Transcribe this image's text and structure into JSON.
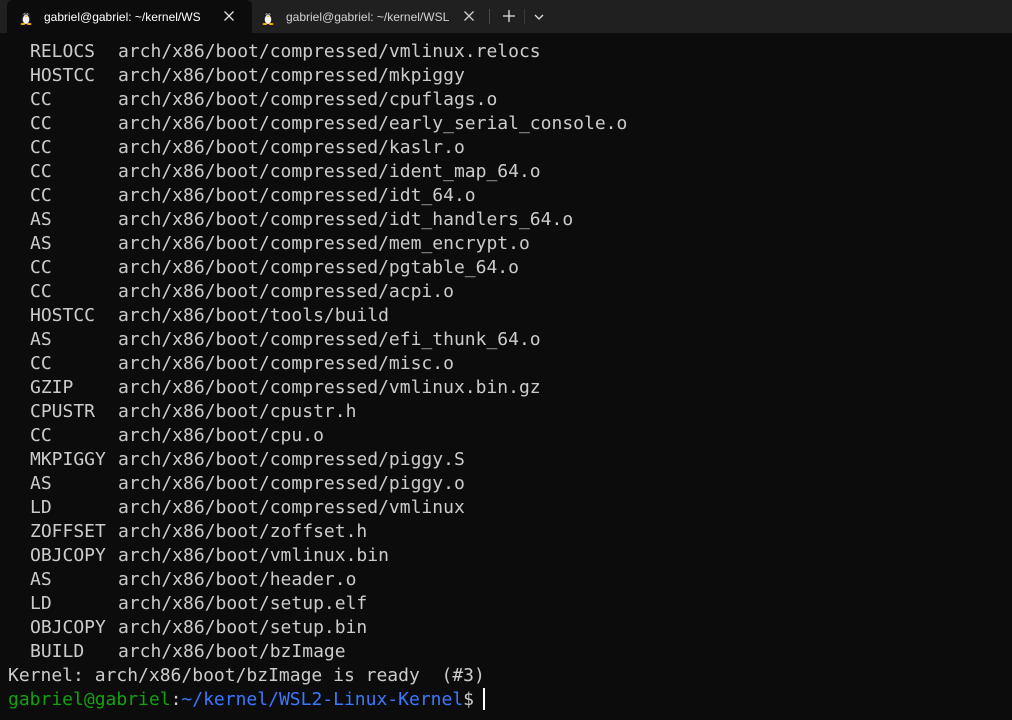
{
  "tabs": [
    {
      "title": "gabriel@gabriel: ~/kernel/WS",
      "active": true,
      "icon": "tux-icon"
    },
    {
      "title": "gabriel@gabriel: ~/kernel/WSL",
      "active": false,
      "icon": "tux-icon"
    }
  ],
  "tabbar": {
    "new_tab_icon": "plus-icon",
    "dropdown_icon": "chevron-down-icon"
  },
  "terminal": {
    "build_lines": [
      {
        "tag": "RELOCS",
        "path": "arch/x86/boot/compressed/vmlinux.relocs"
      },
      {
        "tag": "HOSTCC",
        "path": "arch/x86/boot/compressed/mkpiggy"
      },
      {
        "tag": "CC",
        "path": "arch/x86/boot/compressed/cpuflags.o"
      },
      {
        "tag": "CC",
        "path": "arch/x86/boot/compressed/early_serial_console.o"
      },
      {
        "tag": "CC",
        "path": "arch/x86/boot/compressed/kaslr.o"
      },
      {
        "tag": "CC",
        "path": "arch/x86/boot/compressed/ident_map_64.o"
      },
      {
        "tag": "CC",
        "path": "arch/x86/boot/compressed/idt_64.o"
      },
      {
        "tag": "AS",
        "path": "arch/x86/boot/compressed/idt_handlers_64.o"
      },
      {
        "tag": "AS",
        "path": "arch/x86/boot/compressed/mem_encrypt.o"
      },
      {
        "tag": "CC",
        "path": "arch/x86/boot/compressed/pgtable_64.o"
      },
      {
        "tag": "CC",
        "path": "arch/x86/boot/compressed/acpi.o"
      },
      {
        "tag": "HOSTCC",
        "path": "arch/x86/boot/tools/build"
      },
      {
        "tag": "AS",
        "path": "arch/x86/boot/compressed/efi_thunk_64.o"
      },
      {
        "tag": "CC",
        "path": "arch/x86/boot/compressed/misc.o"
      },
      {
        "tag": "GZIP",
        "path": "arch/x86/boot/compressed/vmlinux.bin.gz"
      },
      {
        "tag": "CPUSTR",
        "path": "arch/x86/boot/cpustr.h"
      },
      {
        "tag": "CC",
        "path": "arch/x86/boot/cpu.o"
      },
      {
        "tag": "MKPIGGY",
        "path": "arch/x86/boot/compressed/piggy.S"
      },
      {
        "tag": "AS",
        "path": "arch/x86/boot/compressed/piggy.o"
      },
      {
        "tag": "LD",
        "path": "arch/x86/boot/compressed/vmlinux"
      },
      {
        "tag": "ZOFFSET",
        "path": "arch/x86/boot/zoffset.h"
      },
      {
        "tag": "OBJCOPY",
        "path": "arch/x86/boot/vmlinux.bin"
      },
      {
        "tag": "AS",
        "path": "arch/x86/boot/header.o"
      },
      {
        "tag": "LD",
        "path": "arch/x86/boot/setup.elf"
      },
      {
        "tag": "OBJCOPY",
        "path": "arch/x86/boot/setup.bin"
      },
      {
        "tag": "BUILD",
        "path": "arch/x86/boot/bzImage"
      }
    ],
    "status_line": "Kernel: arch/x86/boot/bzImage is ready  (#3)",
    "prompt": {
      "user_host": "gabriel@gabriel",
      "separator": ":",
      "cwd": "~/kernel/WSL2-Linux-Kernel",
      "symbol": "$"
    }
  },
  "colors": {
    "background": "#0c0c0c",
    "tabbar": "#202020",
    "text": "#cccccc",
    "prompt_user": "#13a10e",
    "prompt_path": "#3b78ff"
  }
}
